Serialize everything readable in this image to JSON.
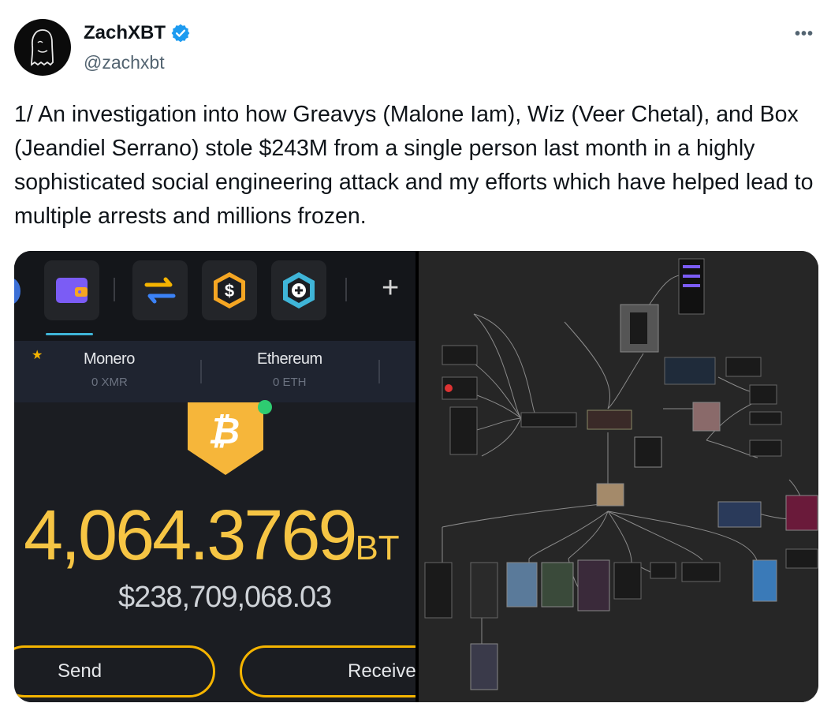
{
  "author": {
    "display_name": "ZachXBT",
    "handle": "@zachxbt",
    "verified": true,
    "verified_color": "#1d9bf0"
  },
  "more_label": "•••",
  "tweet": {
    "text": "1/ An investigation into how Greavys (Malone Iam), Wiz (Veer Chetal), and Box (Jeandiel Serrano) stole $243M from a single person last month in a highly sophisticated social engineering attack and my efforts which have helped lead to multiple arrests and millions frozen."
  },
  "wallet": {
    "tabs": [
      {
        "icon": "wallet-icon"
      },
      {
        "icon": "swap-icon"
      },
      {
        "icon": "dollar-coin-icon"
      },
      {
        "icon": "plus-coin-icon"
      }
    ],
    "add_tab_label": "+",
    "coins": [
      {
        "name": "Monero",
        "amount": "0 XMR"
      },
      {
        "name": "Ethereum",
        "amount": "0 ETH"
      }
    ],
    "balance": "4,064.3769",
    "balance_unit": "BT",
    "fiat_value": "$238,709,068.03",
    "send_label": "Send",
    "receive_label": "Receive",
    "accent_color": "#f6c544",
    "bitcoin_icon": "bitcoin-badge-icon"
  }
}
